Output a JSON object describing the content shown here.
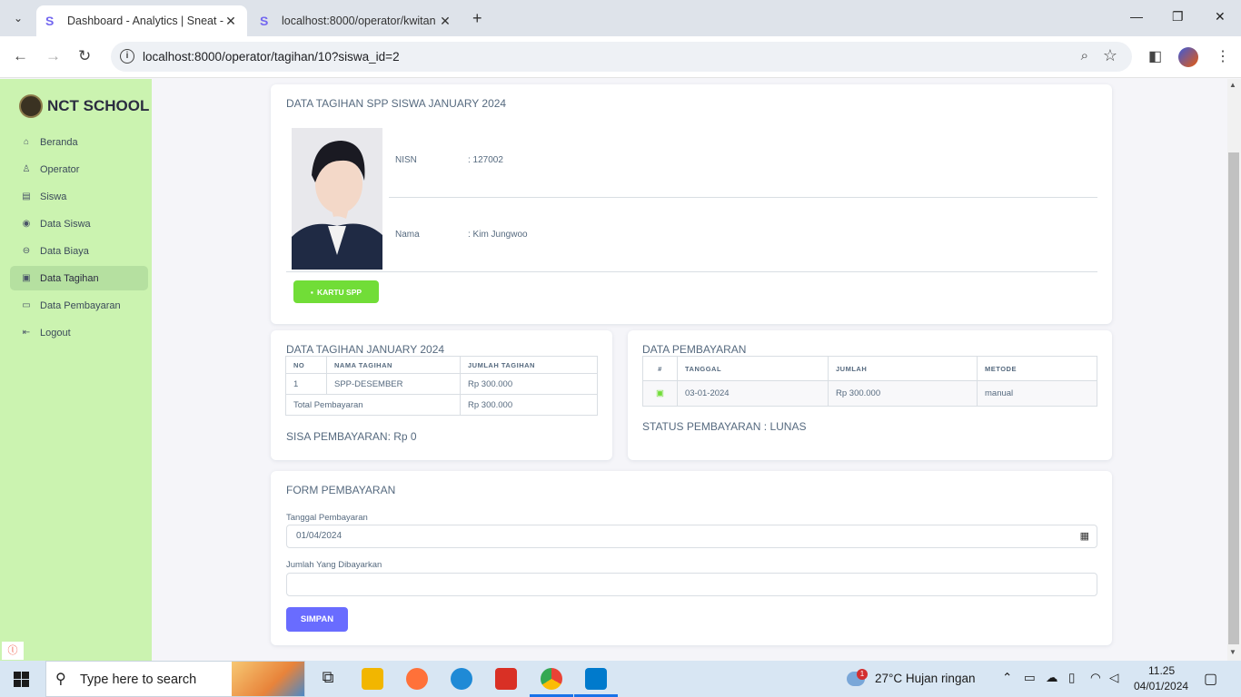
{
  "browser": {
    "tabs": [
      {
        "title": "Dashboard - Analytics | Sneat -",
        "active": true
      },
      {
        "title": "localhost:8000/operator/kwitan",
        "active": false
      }
    ],
    "url": "localhost:8000/operator/tagihan/10?siswa_id=2"
  },
  "sidebar": {
    "brand": "NCT SCHOOL",
    "items": [
      {
        "label": "Beranda",
        "icon": "home-icon"
      },
      {
        "label": "Operator",
        "icon": "user-icon"
      },
      {
        "label": "Siswa",
        "icon": "clipboard-icon"
      },
      {
        "label": "Data Siswa",
        "icon": "user-circle-icon"
      },
      {
        "label": "Data Biaya",
        "icon": "coins-icon"
      },
      {
        "label": "Data Tagihan",
        "icon": "money-icon",
        "active": true
      },
      {
        "label": "Data Pembayaran",
        "icon": "card-icon"
      },
      {
        "label": "Logout",
        "icon": "logout-icon"
      }
    ]
  },
  "student": {
    "title": "DATA TAGIHAN SPP SISWA JANUARY 2024",
    "nisn_label": "NISN",
    "nisn_value": ": 127002",
    "nama_label": "Nama",
    "nama_value": ": Kim Jungwoo",
    "card_button": "KARTU SPP"
  },
  "tagihan": {
    "title": "DATA TAGIHAN JANUARY 2024",
    "headers": [
      "NO",
      "NAMA TAGIHAN",
      "JUMLAH TAGIHAN"
    ],
    "rows": [
      [
        "1",
        "SPP-DESEMBER",
        "Rp 300.000"
      ]
    ],
    "total_label": "Total Pembayaran",
    "total_value": "Rp 300.000",
    "sisa": "SISA PEMBAYARAN: Rp 0"
  },
  "pembayaran": {
    "title": "DATA PEMBAYARAN",
    "headers": [
      "#",
      "TANGGAL",
      "JUMLAH",
      "METODE"
    ],
    "rows": [
      [
        "03-01-2024",
        "Rp 300.000",
        "manual"
      ]
    ],
    "status": "STATUS PEMBAYARAN : LUNAS"
  },
  "form": {
    "title": "FORM PEMBAYARAN",
    "date_label": "Tanggal Pembayaran",
    "date_value": "01/04/2024",
    "amount_label": "Jumlah Yang Dibayarkan",
    "amount_value": "",
    "submit": "SIMPAN"
  },
  "taskbar": {
    "search_placeholder": "Type here to search",
    "weather": "27°C  Hujan ringan",
    "time": "11.25",
    "date": "04/01/2024",
    "notification_count": "1"
  },
  "colors": {
    "sidebar_bg": "#cbf3b0",
    "primary": "#696cff",
    "success": "#71dd37"
  }
}
